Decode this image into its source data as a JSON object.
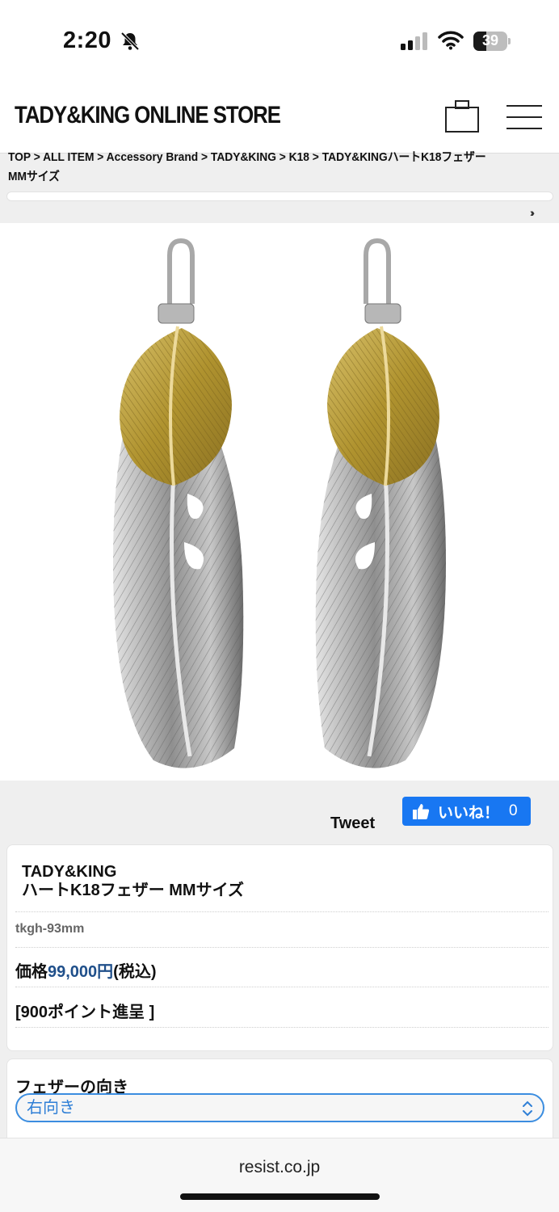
{
  "status_bar": {
    "time": "2:20",
    "battery": "39",
    "battery_level": 0.39
  },
  "header": {
    "logo": "TADY&KING ONLINE STORE"
  },
  "breadcrumb": {
    "text": "TOP > ALL ITEM > Accessory Brand > TADY&KING > K18 > TADY&KINGハートK18フェザー MMサイズ"
  },
  "social": {
    "tweet_label": "Tweet",
    "like_label": "いいね！",
    "like_count": "0"
  },
  "product": {
    "brand": "TADY&KING",
    "name": "ハートK18フェザー MMサイズ",
    "sku": "tkgh-93mm",
    "price_label": "価格",
    "price_amount": "99,000円",
    "price_tax": "(税込)",
    "points": "[900ポイント進呈 ]"
  },
  "options": {
    "label": "フェザーの向き",
    "selected": "右向き"
  },
  "browser": {
    "url": "resist.co.jp"
  },
  "colors": {
    "like_button": "#1877f2",
    "price": "#1f4f8a",
    "select_accent": "#3b8de0"
  }
}
